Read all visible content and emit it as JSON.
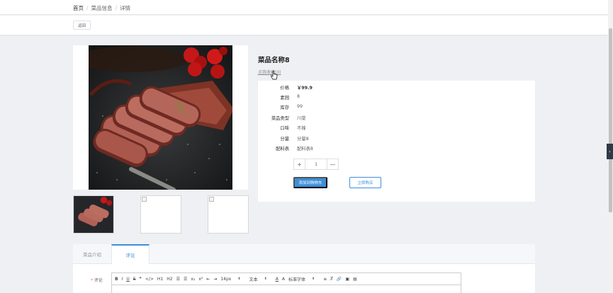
{
  "breadcrumb": {
    "home": "首页",
    "sep1": "/",
    "section": "菜品信息",
    "sep2": "/",
    "current": "详情"
  },
  "back_button": "返回",
  "product": {
    "title": "菜品名称8",
    "favorite_link": "点我收藏(0)",
    "rows": [
      {
        "label": "价格",
        "value": "￥99.9"
      },
      {
        "label": "素园",
        "value": "8"
      },
      {
        "label": "库存",
        "value": "99"
      },
      {
        "label": "菜品类型",
        "value": "川菜"
      },
      {
        "label": "口味",
        "value": "不辣"
      },
      {
        "label": "分量",
        "value": "分量8"
      },
      {
        "label": "配料表",
        "value": "配料表8"
      }
    ],
    "quantity": {
      "plus": "+",
      "value": "1",
      "minus": "—"
    },
    "add_to_cart": "添加到购物车",
    "buy_now": "立即购买"
  },
  "tabs": [
    {
      "label": "菜品介绍"
    },
    {
      "label": "评论"
    }
  ],
  "comment": {
    "required_mark": "*",
    "label": "评论",
    "toolbar": {
      "bold": "B",
      "italic": "I",
      "underline": "U",
      "strike": "S",
      "quote": "❞",
      "code": "</>",
      "h1": "H1",
      "h2": "H2",
      "ordered_list": "☰",
      "bullet_list": "☰",
      "sub": "x₂",
      "sup": "x²",
      "outdent": "⇤",
      "indent": "⇥",
      "size": "14px",
      "block": "文本",
      "color": "A",
      "background": "A",
      "font": "标准字体",
      "align": "≡",
      "clean": "T̸",
      "link": "🔗",
      "image": "▣",
      "video": "▤"
    }
  },
  "side_tab": "‹",
  "colors": {
    "accent": "#3d8fd9",
    "price": "#303133",
    "required": "#f56c6c"
  }
}
